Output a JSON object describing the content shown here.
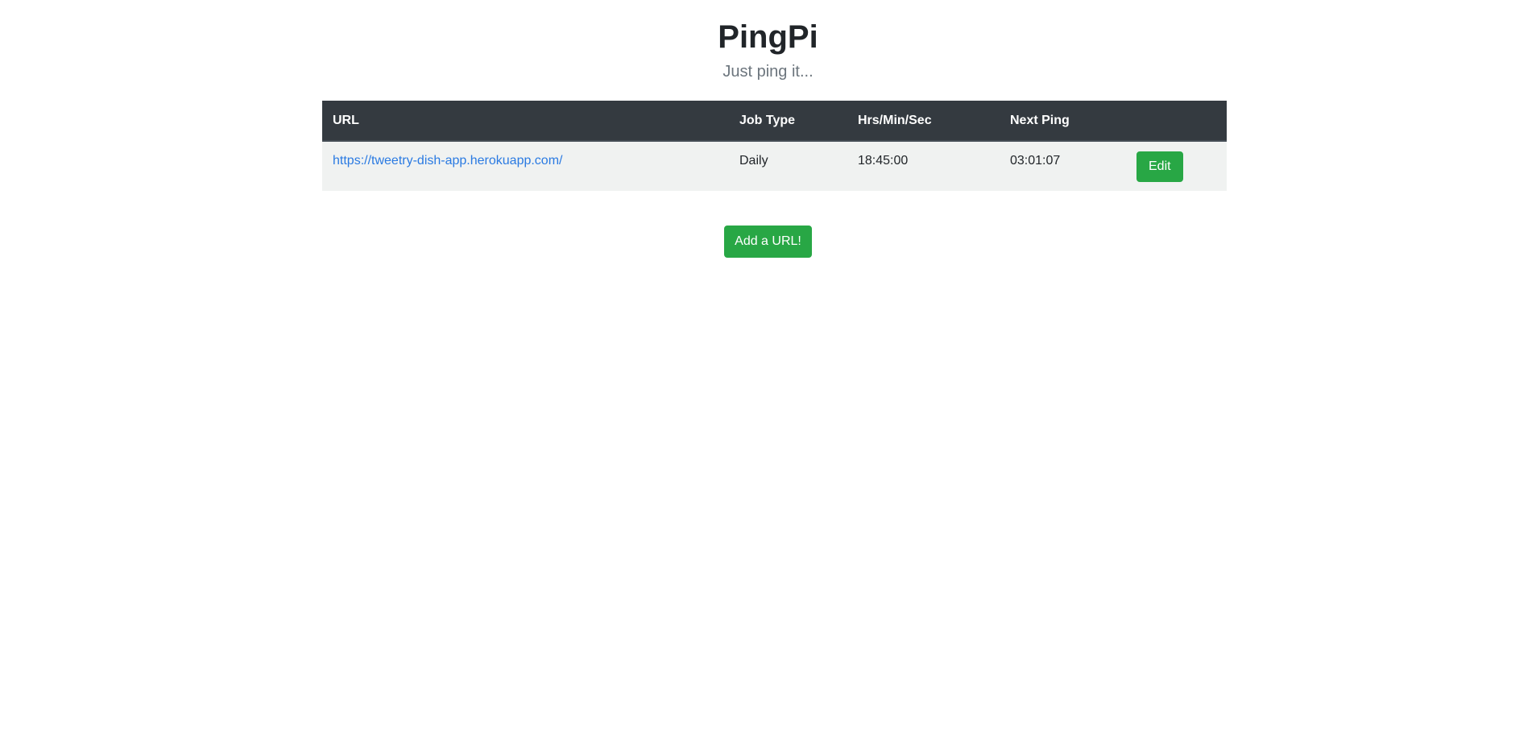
{
  "header": {
    "title": "PingPi",
    "subtitle": "Just ping it..."
  },
  "table": {
    "columns": [
      "URL",
      "Job Type",
      "Hrs/Min/Sec",
      "Next Ping",
      ""
    ],
    "rows": [
      {
        "url": "https://tweetry-dish-app.herokuapp.com/",
        "job_type": "Daily",
        "time": "18:45:00",
        "next_ping": "03:01:07",
        "edit_label": "Edit"
      }
    ]
  },
  "actions": {
    "add_label": "Add a URL!"
  },
  "colors": {
    "header_bg": "#343a40",
    "row_bg": "#f0f2f1",
    "button_green": "#28a745",
    "link_blue": "#2a7ae2"
  }
}
